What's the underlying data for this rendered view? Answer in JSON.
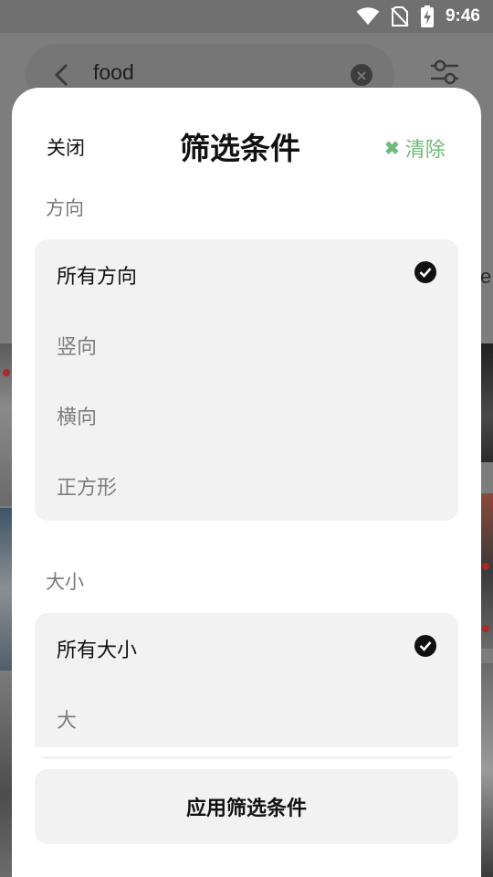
{
  "status_bar": {
    "time": "9:46",
    "icons": [
      "wifi-icon",
      "no-sim-icon",
      "battery-charging-icon"
    ]
  },
  "background_app": {
    "search": {
      "query": "food",
      "back_icon": "chevron-left-icon",
      "clear_icon": "clear-circle-icon"
    },
    "filter_icon": "sliders-icon",
    "peek_text": "e"
  },
  "sheet": {
    "close_label": "关闭",
    "title": "筛选条件",
    "clear": {
      "icon": "x-icon",
      "label": "清除",
      "color": "#6fba7a"
    },
    "orientation": {
      "label": "方向",
      "options": [
        {
          "label": "所有方向",
          "selected": true
        },
        {
          "label": "竖向",
          "selected": false
        },
        {
          "label": "横向",
          "selected": false
        },
        {
          "label": "正方形",
          "selected": false
        }
      ]
    },
    "size": {
      "label": "大小",
      "options": [
        {
          "label": "所有大小",
          "selected": true
        },
        {
          "label": "大",
          "selected": false
        }
      ]
    },
    "apply_label": "应用筛选条件"
  }
}
